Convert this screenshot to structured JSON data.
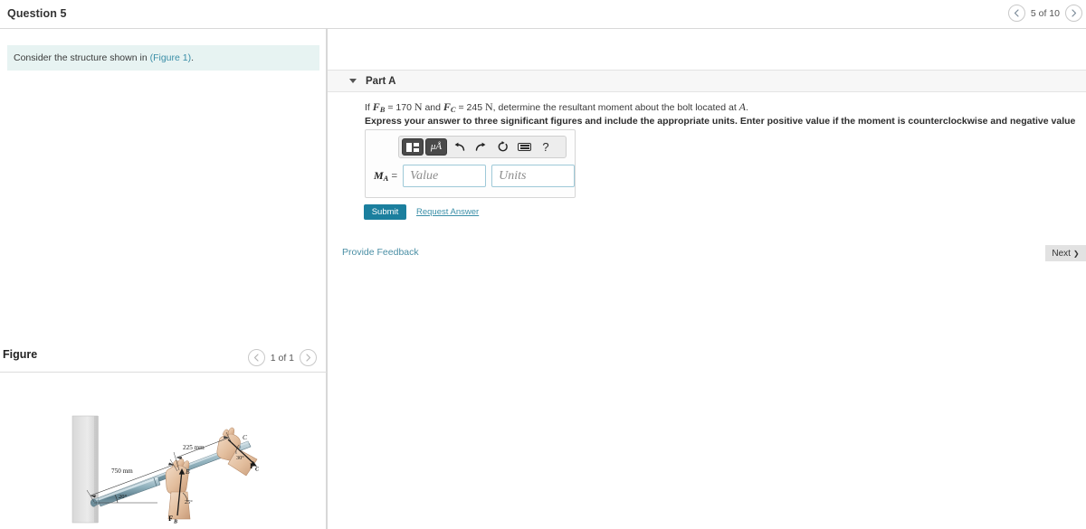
{
  "header": {
    "question_title": "Question 5",
    "pager": {
      "prev_icon": "chevron-left-icon",
      "label": "5 of 10",
      "next_icon": "chevron-right-icon"
    }
  },
  "left_panel": {
    "consider_prefix": "Consider the structure shown in ",
    "figure_link": "(Figure 1)",
    "consider_suffix": ".",
    "figure_heading": "Figure",
    "figure_pager": {
      "prev_icon": "chevron-left-icon",
      "label": "1 of 1",
      "next_icon": "chevron-right-icon"
    }
  },
  "part": {
    "caret_icon": "caret-down-icon",
    "label": "Part A",
    "question_segments": {
      "lead": "If ",
      "f_b": "F",
      "f_b_sub": "B",
      "eq1": " = 170 ",
      "unit1": "N",
      "mid": " and ",
      "f_c": "F",
      "f_c_sub": "C",
      "eq2": " = 245 ",
      "unit2": "N",
      "tail": ", determine the resultant moment about the bolt located at ",
      "point": "A",
      "period": "."
    },
    "instructions": "Express your answer to three significant figures and include the appropriate units. Enter positive value if the moment is counterclockwise and negative value if the moment is clockwise."
  },
  "toolbar": {
    "template_icon": "math-template-icon",
    "units_icon": "micro-angstrom-units-icon",
    "units_text": "μÅ",
    "undo_icon": "undo-arrow-icon",
    "undo_glyph": "↶",
    "redo_icon": "redo-arrow-icon",
    "redo_glyph": "↷",
    "reset_icon": "reset-circle-icon",
    "reset_glyph": "↺",
    "keyboard_icon": "keyboard-icon",
    "help_icon": "help-question-icon",
    "help_glyph": "?"
  },
  "answer": {
    "label_symbol": "M",
    "label_sub": "A",
    "label_equals": "=",
    "value_placeholder": "Value",
    "value_current": "",
    "units_placeholder": "Units",
    "units_current": ""
  },
  "actions": {
    "submit_label": "Submit",
    "request_answer_label": "Request Answer",
    "provide_feedback_label": "Provide Feedback",
    "next_label": "Next",
    "next_icon": "chevron-right-icon",
    "next_glyph": "❯"
  },
  "figure": {
    "alt_name": "bar-anchored-in-wall-with-two-hands-diagram",
    "labels": {
      "dim_long": "750 mm",
      "dim_short": "225 mm",
      "angle_wall": "20°",
      "angle_b": "25°",
      "angle_c": "30°",
      "point_b": "B",
      "point_c": "C",
      "force_b": "F",
      "force_b_sub": "B",
      "force_c": "F",
      "force_c_sub": "C"
    }
  },
  "colors": {
    "accent_teal": "#1b7f9e",
    "link_blue": "#3b8fa8",
    "hint_bg": "#e7f3f2",
    "panel_bg": "#f7f7f7",
    "border": "#d8d8d8",
    "field_border": "#9ec9d8",
    "next_bg": "#e2e2e2",
    "bar_metal": "#8fb0bc",
    "skin": "#e6c2a6"
  }
}
